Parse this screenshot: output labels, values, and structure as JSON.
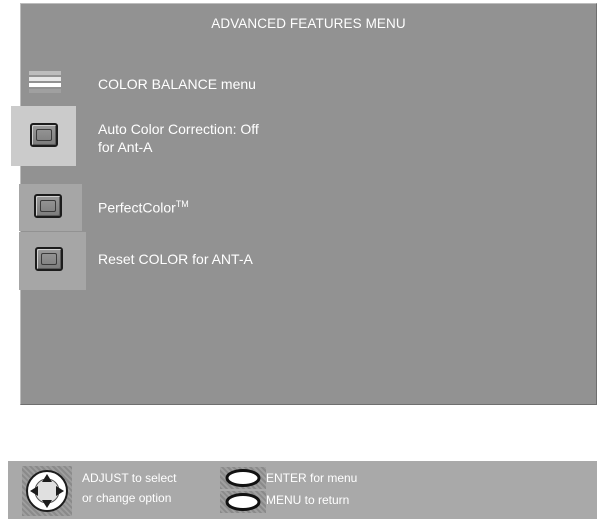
{
  "menu": {
    "title": "ADVANCED FEATURES MENU",
    "items": [
      {
        "label": "COLOR BALANCE menu",
        "icon": "color-balance-icon"
      },
      {
        "label_line1": "Auto Color Correction: Off",
        "label_line2": "for Ant-A",
        "icon": "button-icon",
        "selected": true
      },
      {
        "label": "PerfectColor",
        "trademark": "TM",
        "icon": "button-icon"
      },
      {
        "label": "Reset COLOR for ANT-A",
        "icon": "button-icon"
      }
    ]
  },
  "footer": {
    "adjust_line1": "ADJUST to select",
    "adjust_line2": "or change option",
    "enter_text": "ENTER for menu",
    "menu_text": "MENU to return"
  },
  "colors": {
    "panel": "#929292",
    "selected_tile": "#cbcbcb",
    "footer": "#a9a9a9"
  }
}
